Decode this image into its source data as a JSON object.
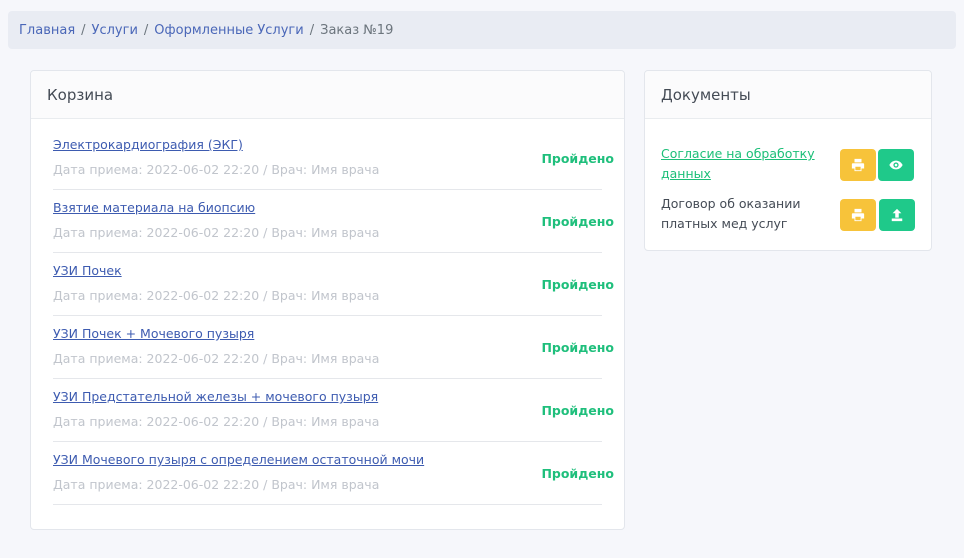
{
  "breadcrumb": {
    "items": [
      "Главная",
      "Услуги",
      "Оформленные Услуги"
    ],
    "separator": "/",
    "current": "Заказ №19"
  },
  "cart": {
    "title": "Корзина",
    "services": [
      {
        "name": "Электрокардиография (ЭКГ)",
        "meta": "Дата приема: 2022-06-02 22:20 / Врач: Имя врача",
        "status": "Пройдено"
      },
      {
        "name": "Взятие материала на биопсию",
        "meta": "Дата приема: 2022-06-02 22:20 / Врач: Имя врача",
        "status": "Пройдено"
      },
      {
        "name": "УЗИ Почек",
        "meta": "Дата приема: 2022-06-02 22:20 / Врач: Имя врача",
        "status": "Пройдено"
      },
      {
        "name": "УЗИ Почек + Мочевого пузыря",
        "meta": "Дата приема: 2022-06-02 22:20 / Врач: Имя врача",
        "status": "Пройдено"
      },
      {
        "name": "УЗИ Предстательной железы + мочевого пузыря",
        "meta": "Дата приема: 2022-06-02 22:20 / Врач: Имя врача",
        "status": "Пройдено"
      },
      {
        "name": "УЗИ Мочевого пузыря с определением остаточной мочи",
        "meta": "Дата приема: 2022-06-02 22:20 / Врач: Имя врача",
        "status": "Пройдено"
      }
    ]
  },
  "documents": {
    "title": "Документы",
    "items": [
      {
        "label": "Согласие на обработку данных",
        "actions": [
          "print-icon",
          "eye-icon"
        ]
      },
      {
        "label": "Договор об оказании платных мед услуг",
        "actions": [
          "print-icon",
          "upload-icon"
        ]
      }
    ]
  },
  "colors": {
    "accent_blue": "#3d5bb0",
    "status_green": "#1fbf7c",
    "button_yellow": "#f7c33a",
    "button_green": "#1fc98a"
  }
}
